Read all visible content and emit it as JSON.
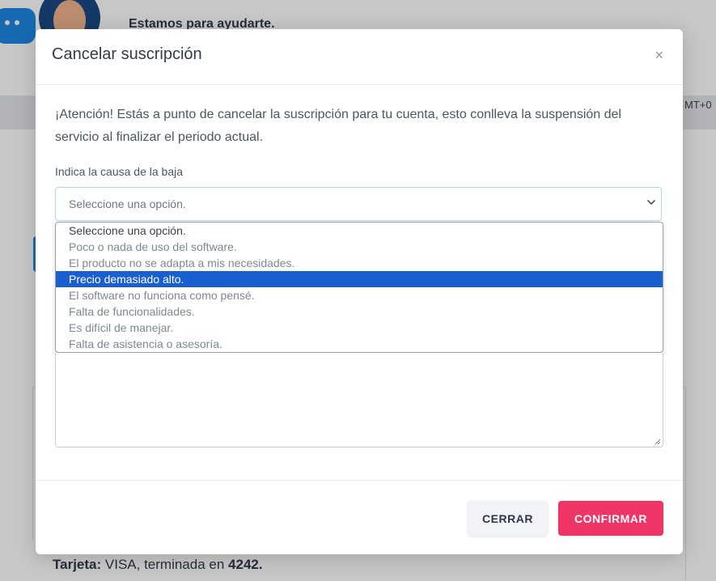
{
  "background": {
    "help_text": "Estamos para ayudarte.",
    "timezone_fragment": "MT+0",
    "card_label": "Tarjeta:",
    "card_brand": " VISA, terminada en ",
    "card_last4": "4242."
  },
  "modal": {
    "title": "Cancelar suscripción",
    "close_symbol": "×",
    "warning": "¡Atención! Estás a punto de cancelar la suscripción para tu cuenta, esto conlleva la suspensión del servicio al finalizar el periodo actual.",
    "reason_label": "Indica la causa de la baja",
    "reason_select": {
      "value": "Seleccione una opción.",
      "options": [
        "Seleccione una opción.",
        "Poco o nada de uso del software.",
        "El producto no se adapta a mis necesidades.",
        "Precio demasiado alto.",
        "El software no funciona como pensé.",
        "Falta de funcionalidades.",
        "Es difícil de manejar.",
        "Falta de asistencia o asesoría."
      ],
      "highlighted": "Precio demasiado alto."
    },
    "buttons": {
      "close": "CERRAR",
      "confirm": "CONFIRMAR"
    }
  },
  "colors": {
    "confirm": "#ee3565",
    "highlight": "#1a5fd1",
    "chat_icon": "#1e88e5"
  }
}
